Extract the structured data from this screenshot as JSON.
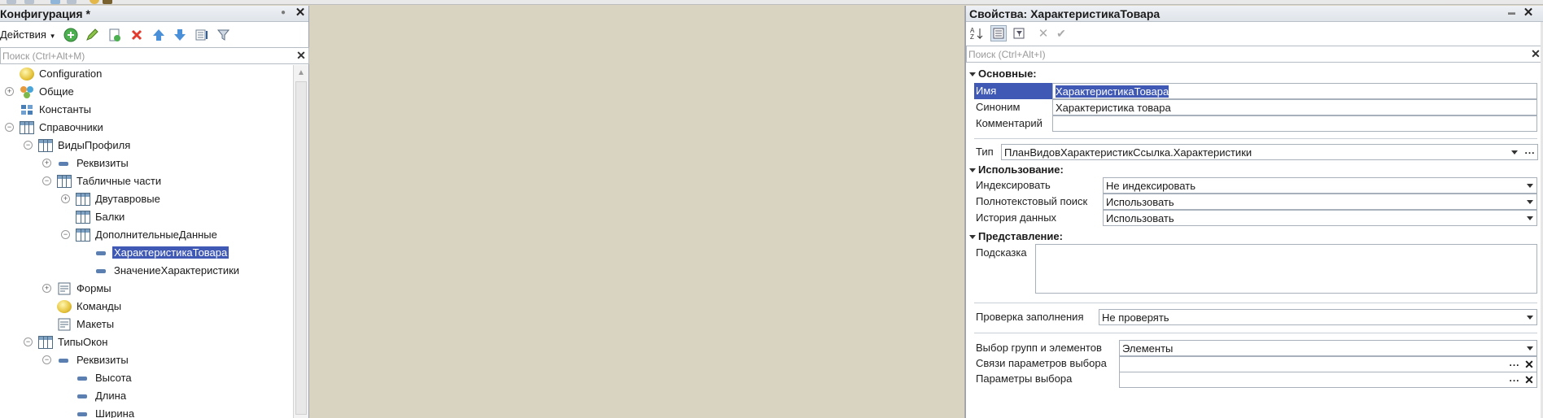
{
  "left_panel": {
    "title": "Конфигурация *",
    "actions_label": "Действия",
    "search_placeholder": "Поиск (Ctrl+Alt+M)",
    "tree": [
      {
        "label": "Configuration",
        "icon": "configuration-icon",
        "level": 0,
        "expander": ""
      },
      {
        "label": "Общие",
        "icon": "common-icon",
        "level": 0,
        "expander": "+"
      },
      {
        "label": "Константы",
        "icon": "constants-icon",
        "level": 0,
        "expander": ""
      },
      {
        "label": "Справочники",
        "icon": "catalog-icon",
        "level": 0,
        "expander": "-"
      },
      {
        "label": "ВидыПрофиля",
        "icon": "catalog-icon",
        "level": 1,
        "expander": "-"
      },
      {
        "label": "Реквизиты",
        "icon": "attribute-icon",
        "level": 2,
        "expander": "+"
      },
      {
        "label": "Табличные части",
        "icon": "tabular-section-icon",
        "level": 2,
        "expander": "-"
      },
      {
        "label": "Двутавровые",
        "icon": "tabular-section-icon",
        "level": 3,
        "expander": "+"
      },
      {
        "label": "Балки",
        "icon": "tabular-section-icon",
        "level": 3,
        "expander": ""
      },
      {
        "label": "ДополнительныеДанные",
        "icon": "tabular-section-icon",
        "level": 3,
        "expander": "-"
      },
      {
        "label": "ХарактеристикаТовара",
        "icon": "attribute-icon",
        "level": 4,
        "expander": "",
        "selected": true
      },
      {
        "label": "ЗначениеХарактеристики",
        "icon": "attribute-icon",
        "level": 4,
        "expander": ""
      },
      {
        "label": "Формы",
        "icon": "form-icon",
        "level": 2,
        "expander": "+"
      },
      {
        "label": "Команды",
        "icon": "command-icon",
        "level": 2,
        "expander": ""
      },
      {
        "label": "Макеты",
        "icon": "template-icon",
        "level": 2,
        "expander": ""
      },
      {
        "label": "ТипыОкон",
        "icon": "catalog-icon",
        "level": 1,
        "expander": "-"
      },
      {
        "label": "Реквизиты",
        "icon": "attribute-icon",
        "level": 2,
        "expander": "-"
      },
      {
        "label": "Высота",
        "icon": "attribute-icon",
        "level": 3,
        "expander": ""
      },
      {
        "label": "Длина",
        "icon": "attribute-icon",
        "level": 3,
        "expander": ""
      },
      {
        "label": "Ширина",
        "icon": "attribute-icon",
        "level": 3,
        "expander": ""
      }
    ]
  },
  "right_panel": {
    "title": "Свойства: ХарактеристикаТовара",
    "search_placeholder": "Поиск (Ctrl+Alt+I)",
    "sections": {
      "basic": "Основные:",
      "usage": "Использование:",
      "presentation": "Представление:"
    },
    "props": {
      "name_label": "Имя",
      "name_value": "ХарактеристикаТовара",
      "synonym_label": "Синоним",
      "synonym_value": "Характеристика товара",
      "comment_label": "Комментарий",
      "comment_value": "",
      "type_label": "Тип",
      "type_value": "ПланВидовХарактеристикСсылка.Характеристики",
      "index_label": "Индексировать",
      "index_value": "Не индексировать",
      "fulltext_label": "Полнотекстовый поиск",
      "fulltext_value": "Использовать",
      "history_label": "История данных",
      "history_value": "Использовать",
      "tooltip_label": "Подсказка",
      "tooltip_value": "",
      "fillcheck_label": "Проверка заполнения",
      "fillcheck_value": "Не проверять",
      "choice_groups_label": "Выбор групп и элементов",
      "choice_groups_value": "Элементы",
      "choice_links_label": "Связи параметров выбора",
      "choice_links_value": "",
      "choice_params_label": "Параметры выбора",
      "choice_params_value": ""
    }
  },
  "colors": {
    "selection": "#3f59b5",
    "workspace": "#d9d4c1"
  }
}
